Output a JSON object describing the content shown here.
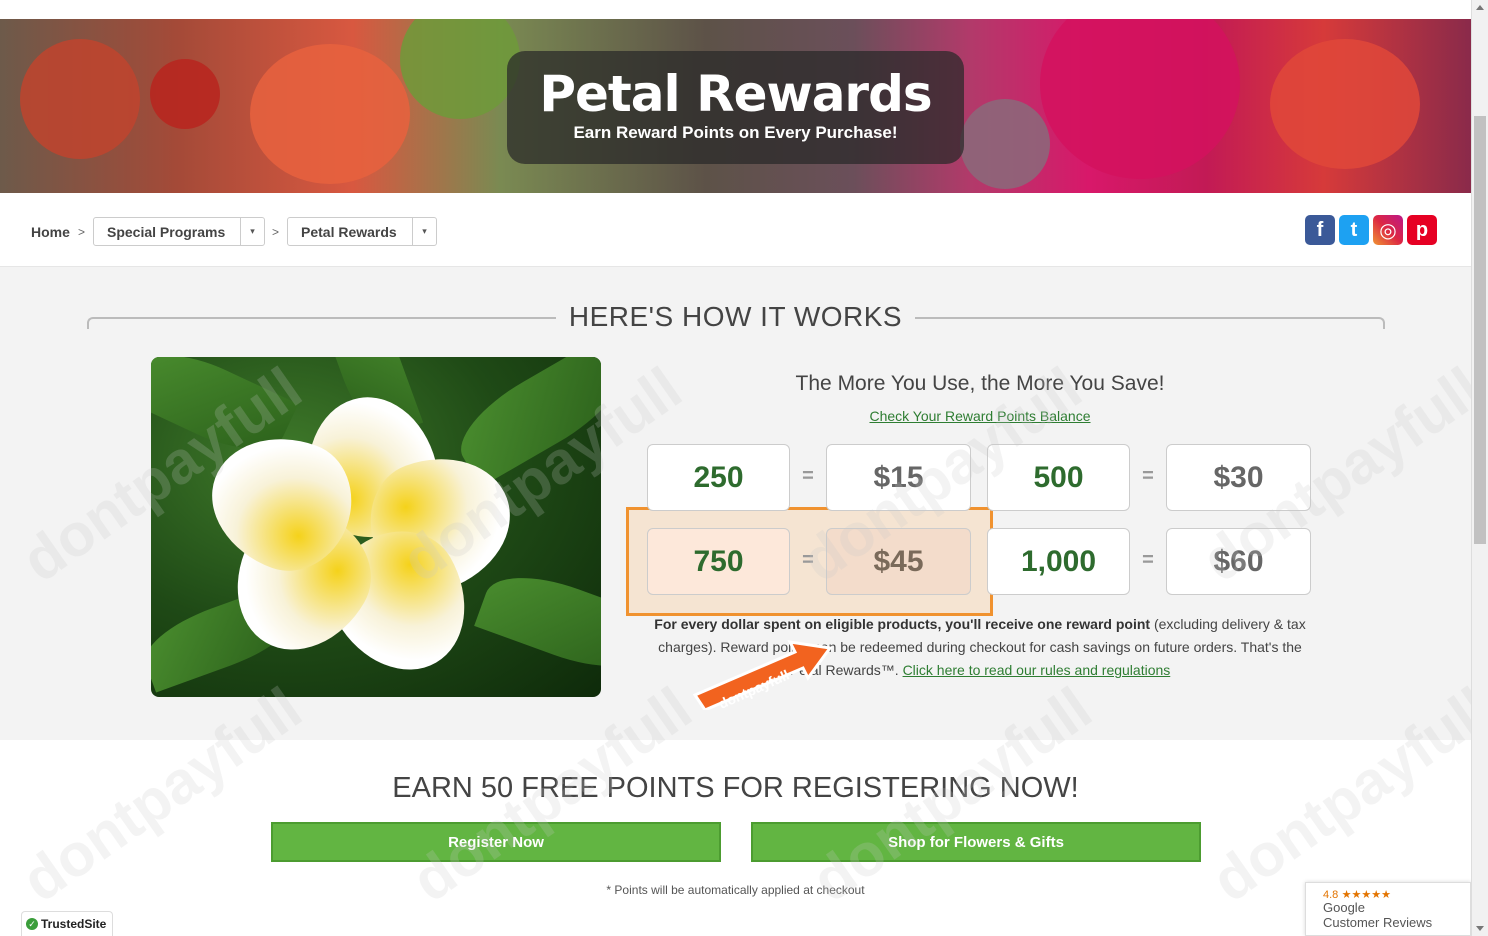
{
  "hero": {
    "title": "Petal Rewards",
    "subtitle": "Earn Reward Points on Every Purchase!"
  },
  "breadcrumb": {
    "home": "Home",
    "separator": ">",
    "items": [
      {
        "label": "Special Programs"
      },
      {
        "label": "Petal Rewards"
      }
    ],
    "caret": "▾"
  },
  "social": [
    {
      "name": "facebook-icon",
      "glyph": "f",
      "color": "#3b5998"
    },
    {
      "name": "twitter-icon",
      "glyph": "t",
      "color": "#1da1f2"
    },
    {
      "name": "instagram-icon",
      "glyph": "◎",
      "color": "#c13584"
    },
    {
      "name": "pinterest-icon",
      "glyph": "p",
      "color": "#e60023"
    }
  ],
  "how": {
    "title": "HERE'S HOW IT WORKS",
    "save_title": "The More You Use, the More You Save!",
    "check_link": "Check Your Reward Points Balance",
    "tiers": [
      {
        "points": "250",
        "cash": "$15"
      },
      {
        "points": "500",
        "cash": "$30"
      },
      {
        "points": "750",
        "cash": "$45"
      },
      {
        "points": "1,000",
        "cash": "$60"
      }
    ],
    "equals": "=",
    "desc_bold": "For every dollar spent on eligible products, you'll receive one reward point",
    "desc_rest_1": " (excluding delivery & tax charges). Reward points can be redeemed during checkout for cash savings on future orders. That's the ",
    "desc_rest_2": "Petal Rewards™. ",
    "desc_link": "Click here to read our rules and regulations"
  },
  "badge": {
    "text": "dontpayfull"
  },
  "register": {
    "title": "EARN 50 FREE POINTS FOR REGISTERING NOW!",
    "register_button": "Register Now",
    "shop_button": "Shop for Flowers & Gifts",
    "note": "* Points will be automatically applied at checkout"
  },
  "trusted": {
    "label": "TrustedSite",
    "check": "✓"
  },
  "google_reviews": {
    "rating": "4.8",
    "stars": "★★★★★",
    "brand": "Google",
    "label": "Customer Reviews"
  },
  "watermark": "dontpayfull",
  "colors": {
    "accent_green": "#62b542",
    "points_green": "#2e6b2e",
    "link_green": "#2e7d32",
    "highlight_orange": "#f0922f"
  }
}
